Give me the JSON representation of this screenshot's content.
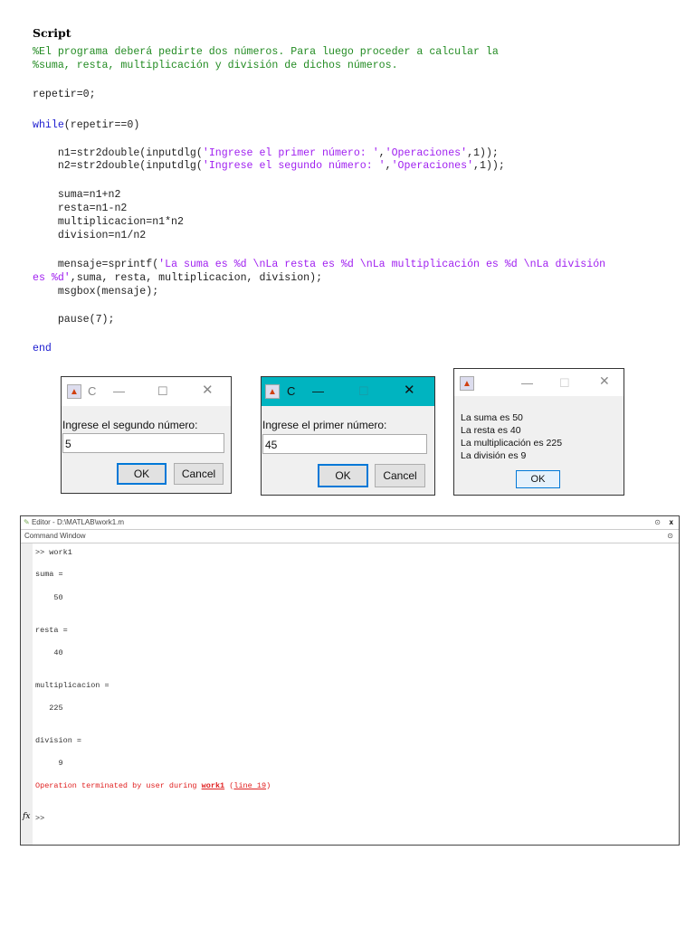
{
  "doc": {
    "heading": "Script"
  },
  "code": {
    "lines": [
      [
        {
          "t": "%El programa deberá pedirte dos números. Para luego proceder a calcular la",
          "c": "cm"
        }
      ],
      [
        {
          "t": "%suma, resta, multiplicación y división de dichos números.",
          "c": "cm"
        }
      ],
      [
        {
          "t": "repetir=0;",
          "c": "tx"
        }
      ],
      [
        {
          "t": "while",
          "c": "kw"
        },
        {
          "t": "(repetir==0)",
          "c": "tx"
        }
      ],
      [
        {
          "t": "    n1=str2double(inputdlg(",
          "c": "tx"
        },
        {
          "t": "'Ingrese el primer número: '",
          "c": "st"
        },
        {
          "t": ",",
          "c": "tx"
        },
        {
          "t": "'Operaciones'",
          "c": "st"
        },
        {
          "t": ",1));",
          "c": "tx"
        }
      ],
      [
        {
          "t": "    n2=str2double(inputdlg(",
          "c": "tx"
        },
        {
          "t": "'Ingrese el segundo número: '",
          "c": "st"
        },
        {
          "t": ",",
          "c": "tx"
        },
        {
          "t": "'Operaciones'",
          "c": "st"
        },
        {
          "t": ",1));",
          "c": "tx"
        }
      ],
      [
        {
          "t": "    suma=n1+n2",
          "c": "tx"
        }
      ],
      [
        {
          "t": "    resta=n1-n2",
          "c": "tx"
        }
      ],
      [
        {
          "t": "    multiplicacion=n1*n2",
          "c": "tx"
        }
      ],
      [
        {
          "t": "    division=n1/n2",
          "c": "tx"
        }
      ],
      [
        {
          "t": "    mensaje=sprintf(",
          "c": "tx"
        },
        {
          "t": "'La suma es %d \\nLa resta es %d \\nLa multiplicación es %d \\nLa división",
          "c": "st"
        }
      ],
      [
        {
          "t": "es %d'",
          "c": "st"
        },
        {
          "t": ",suma, resta, multiplicacion, division);",
          "c": "tx"
        }
      ],
      [
        {
          "t": "    msgbox(mensaje);",
          "c": "tx"
        }
      ],
      [
        {
          "t": "    pause(7);",
          "c": "tx"
        }
      ],
      [
        {
          "t": "end",
          "c": "kw"
        }
      ]
    ]
  },
  "dialogs": {
    "second": {
      "title": "C",
      "prompt": "Ingrese el segundo número:",
      "value": "5",
      "ok": "OK",
      "cancel": "Cancel"
    },
    "first": {
      "title": "C",
      "prompt": "Ingrese el primer número:",
      "value": "45",
      "ok": "OK",
      "cancel": "Cancel",
      "title_color": "#00b4c0"
    },
    "result": {
      "lines": [
        "La suma es 50",
        "La resta es 40",
        "La multiplicación es 225",
        "La división es 9"
      ],
      "ok": "OK"
    }
  },
  "command_window": {
    "editor_title": "Editor - D:\\MATLAB\\work1.m",
    "panel_title": "Command Window",
    "close": "x",
    "lines": [
      ">> work1",
      "suma =",
      "    50",
      "resta =",
      "    40",
      "multiplicacion =",
      "   225",
      "division =",
      "     9"
    ],
    "error": {
      "prefix": "Operation terminated by user during ",
      "link1": "work1",
      "mid": " (",
      "link2": "line 19",
      "suffix": ")"
    },
    "prompt": ">>",
    "fx": "fx"
  }
}
